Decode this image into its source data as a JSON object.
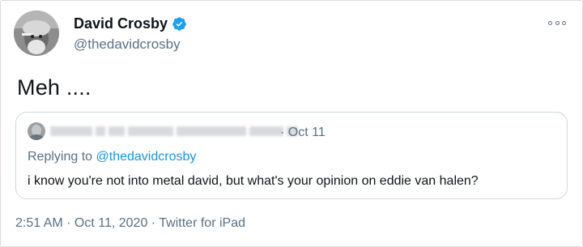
{
  "author": {
    "name": "David Crosby",
    "handle": "@thedavidcrosby",
    "verified": true
  },
  "tweet": {
    "text": "Meh ...."
  },
  "quoted": {
    "date": "· Oct 11",
    "replying_prefix": "Replying to ",
    "replying_handle": "@thedavidcrosby",
    "text": "i  know you're not into metal david, but what's your opinion on eddie van halen?"
  },
  "meta": {
    "timestamp": "2:51 AM · Oct 11, 2020 · Twitter for iPad"
  },
  "colors": {
    "accent": "#1da1f2",
    "secondary_text": "#5b7083",
    "primary_text": "#0f1419",
    "border": "#cfd9de"
  },
  "icons": [
    "verified-badge-icon",
    "more-options-icon"
  ]
}
